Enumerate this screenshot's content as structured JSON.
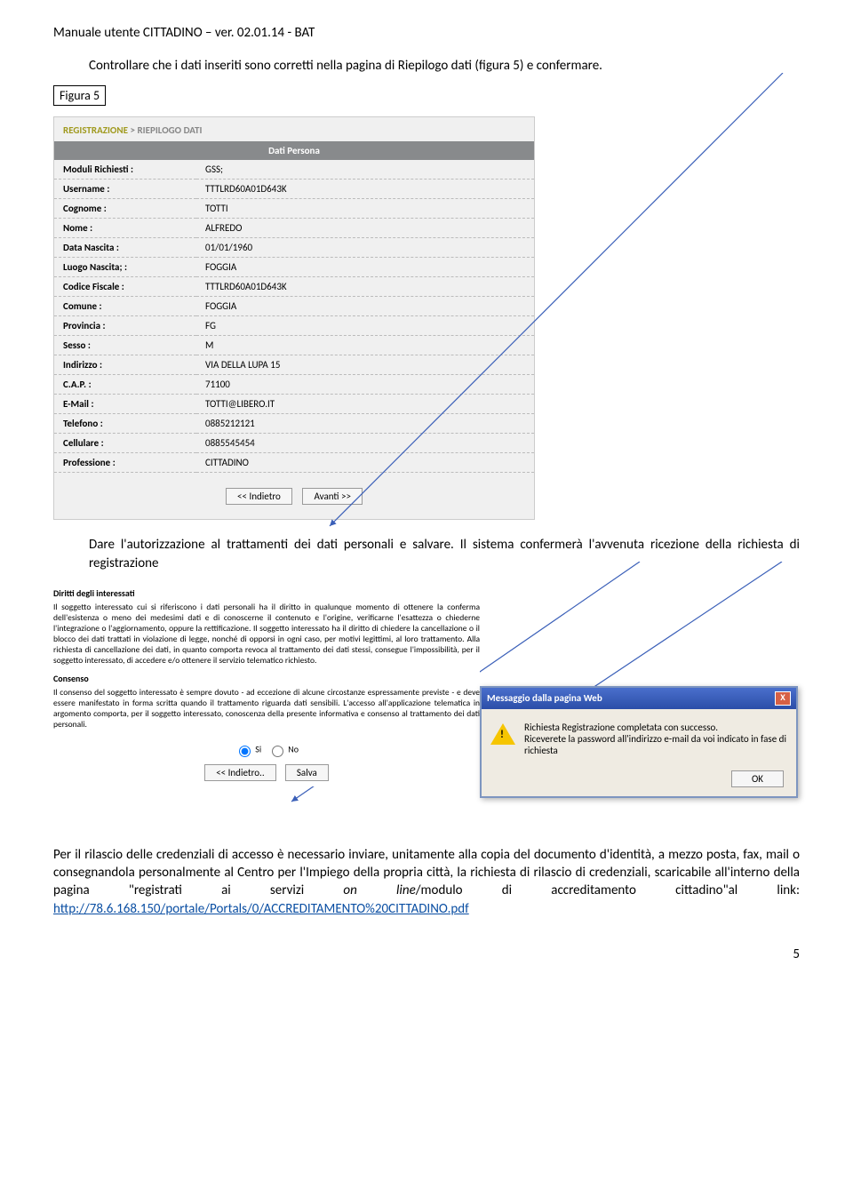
{
  "doc": {
    "header": "Manuale utente CITTADINO – ver. 02.01.14 - BAT",
    "intro": "Controllare che i dati inseriti sono corretti nella pagina di Riepilogo dati  (figura 5) e confermare.",
    "figure_label": "Figura 5",
    "mid_text": "Dare l'autorizzazione al trattamenti dei dati personali e salvare. Il sistema confermerà l'avvenuta ricezione della richiesta di registrazione",
    "final_text_1": "Per il rilascio delle credenziali di accesso è necessario inviare, unitamente alla copia del documento d'identità, a mezzo posta, fax, mail o consegnandola personalmente al Centro per l'Impiego della propria città, la richiesta di rilascio di credenziali, scaricabile all'interno della pagina \"registrati ai servizi ",
    "final_text_italic": "on line",
    "final_text_2": "/modulo di accreditamento cittadino\"al link:  ",
    "final_link": "http://78.6.168.150/portale/Portals/0/ACCREDITAMENTO%20CITTADINO.pdf",
    "page_number": "5"
  },
  "riepilogo": {
    "breadcrumb_a": "REGISTRAZIONE",
    "breadcrumb_sep": ">",
    "breadcrumb_b": "RIEPILOGO DATI",
    "table_header": "Dati Persona",
    "rows": [
      {
        "label": "Moduli Richiesti :",
        "value": "GSS;"
      },
      {
        "label": "Username :",
        "value": "TTTLRD60A01D643K"
      },
      {
        "label": "Cognome :",
        "value": "TOTTI"
      },
      {
        "label": "Nome :",
        "value": "ALFREDO"
      },
      {
        "label": "Data Nascita :",
        "value": "01/01/1960"
      },
      {
        "label": "Luogo Nascita; :",
        "value": "FOGGIA"
      },
      {
        "label": "Codice Fiscale :",
        "value": "TTTLRD60A01D643K"
      },
      {
        "label": "Comune :",
        "value": "FOGGIA"
      },
      {
        "label": "Provincia :",
        "value": "FG"
      },
      {
        "label": "Sesso :",
        "value": "M"
      },
      {
        "label": "Indirizzo :",
        "value": "VIA DELLA LUPA 15"
      },
      {
        "label": "C.A.P. :",
        "value": "71100"
      },
      {
        "label": "E-Mail :",
        "value": "TOTTI@LIBERO.IT"
      },
      {
        "label": "Telefono :",
        "value": "0885212121"
      },
      {
        "label": "Cellulare :",
        "value": "0885545454"
      },
      {
        "label": "Professione :",
        "value": "CITTADINO"
      }
    ],
    "btn_back": "<< Indietro",
    "btn_next": "Avanti >>"
  },
  "consent": {
    "h1": "Diritti degli interessati",
    "p1": "Il soggetto interessato cui si riferiscono i dati personali ha il diritto in qualunque momento di ottenere la conferma dell'esistenza o meno dei medesimi dati e di conoscerne il contenuto e l'origine, verificarne l'esattezza o chiederne l'integrazione o l'aggiornamento, oppure la rettificazione. Il soggetto interessato ha il diritto di chiedere la cancellazione o il blocco dei dati trattati in violazione di legge, nonché di opporsi in ogni caso, per motivi legittimi, al loro trattamento. Alla richiesta di cancellazione dei dati, in quanto comporta revoca al trattamento dei dati stessi, consegue l'impossibilità, per il soggetto interessato, di accedere e/o ottenere il servizio telematico richiesto.",
    "h2": "Consenso",
    "p2": "Il consenso del soggetto interessato è sempre dovuto - ad eccezione di alcune circostanze espressamente previste - e deve essere manifestato in forma scritta quando il trattamento riguarda dati sensibili. L'accesso all'applicazione telematica in argomento comporta, per il soggetto interessato, conoscenza della presente informativa e consenso al trattamento dei dati personali.",
    "opt_si": "Si",
    "opt_no": "No",
    "btn_back": "<< Indietro..",
    "btn_save": "Salva"
  },
  "dialog": {
    "title": "Messaggio dalla pagina Web",
    "line1": "Richiesta Registrazione completata con successo.",
    "line2": "Riceverete la password all'indirizzo e-mail da voi indicato in fase di richiesta",
    "btn_ok": "OK"
  }
}
